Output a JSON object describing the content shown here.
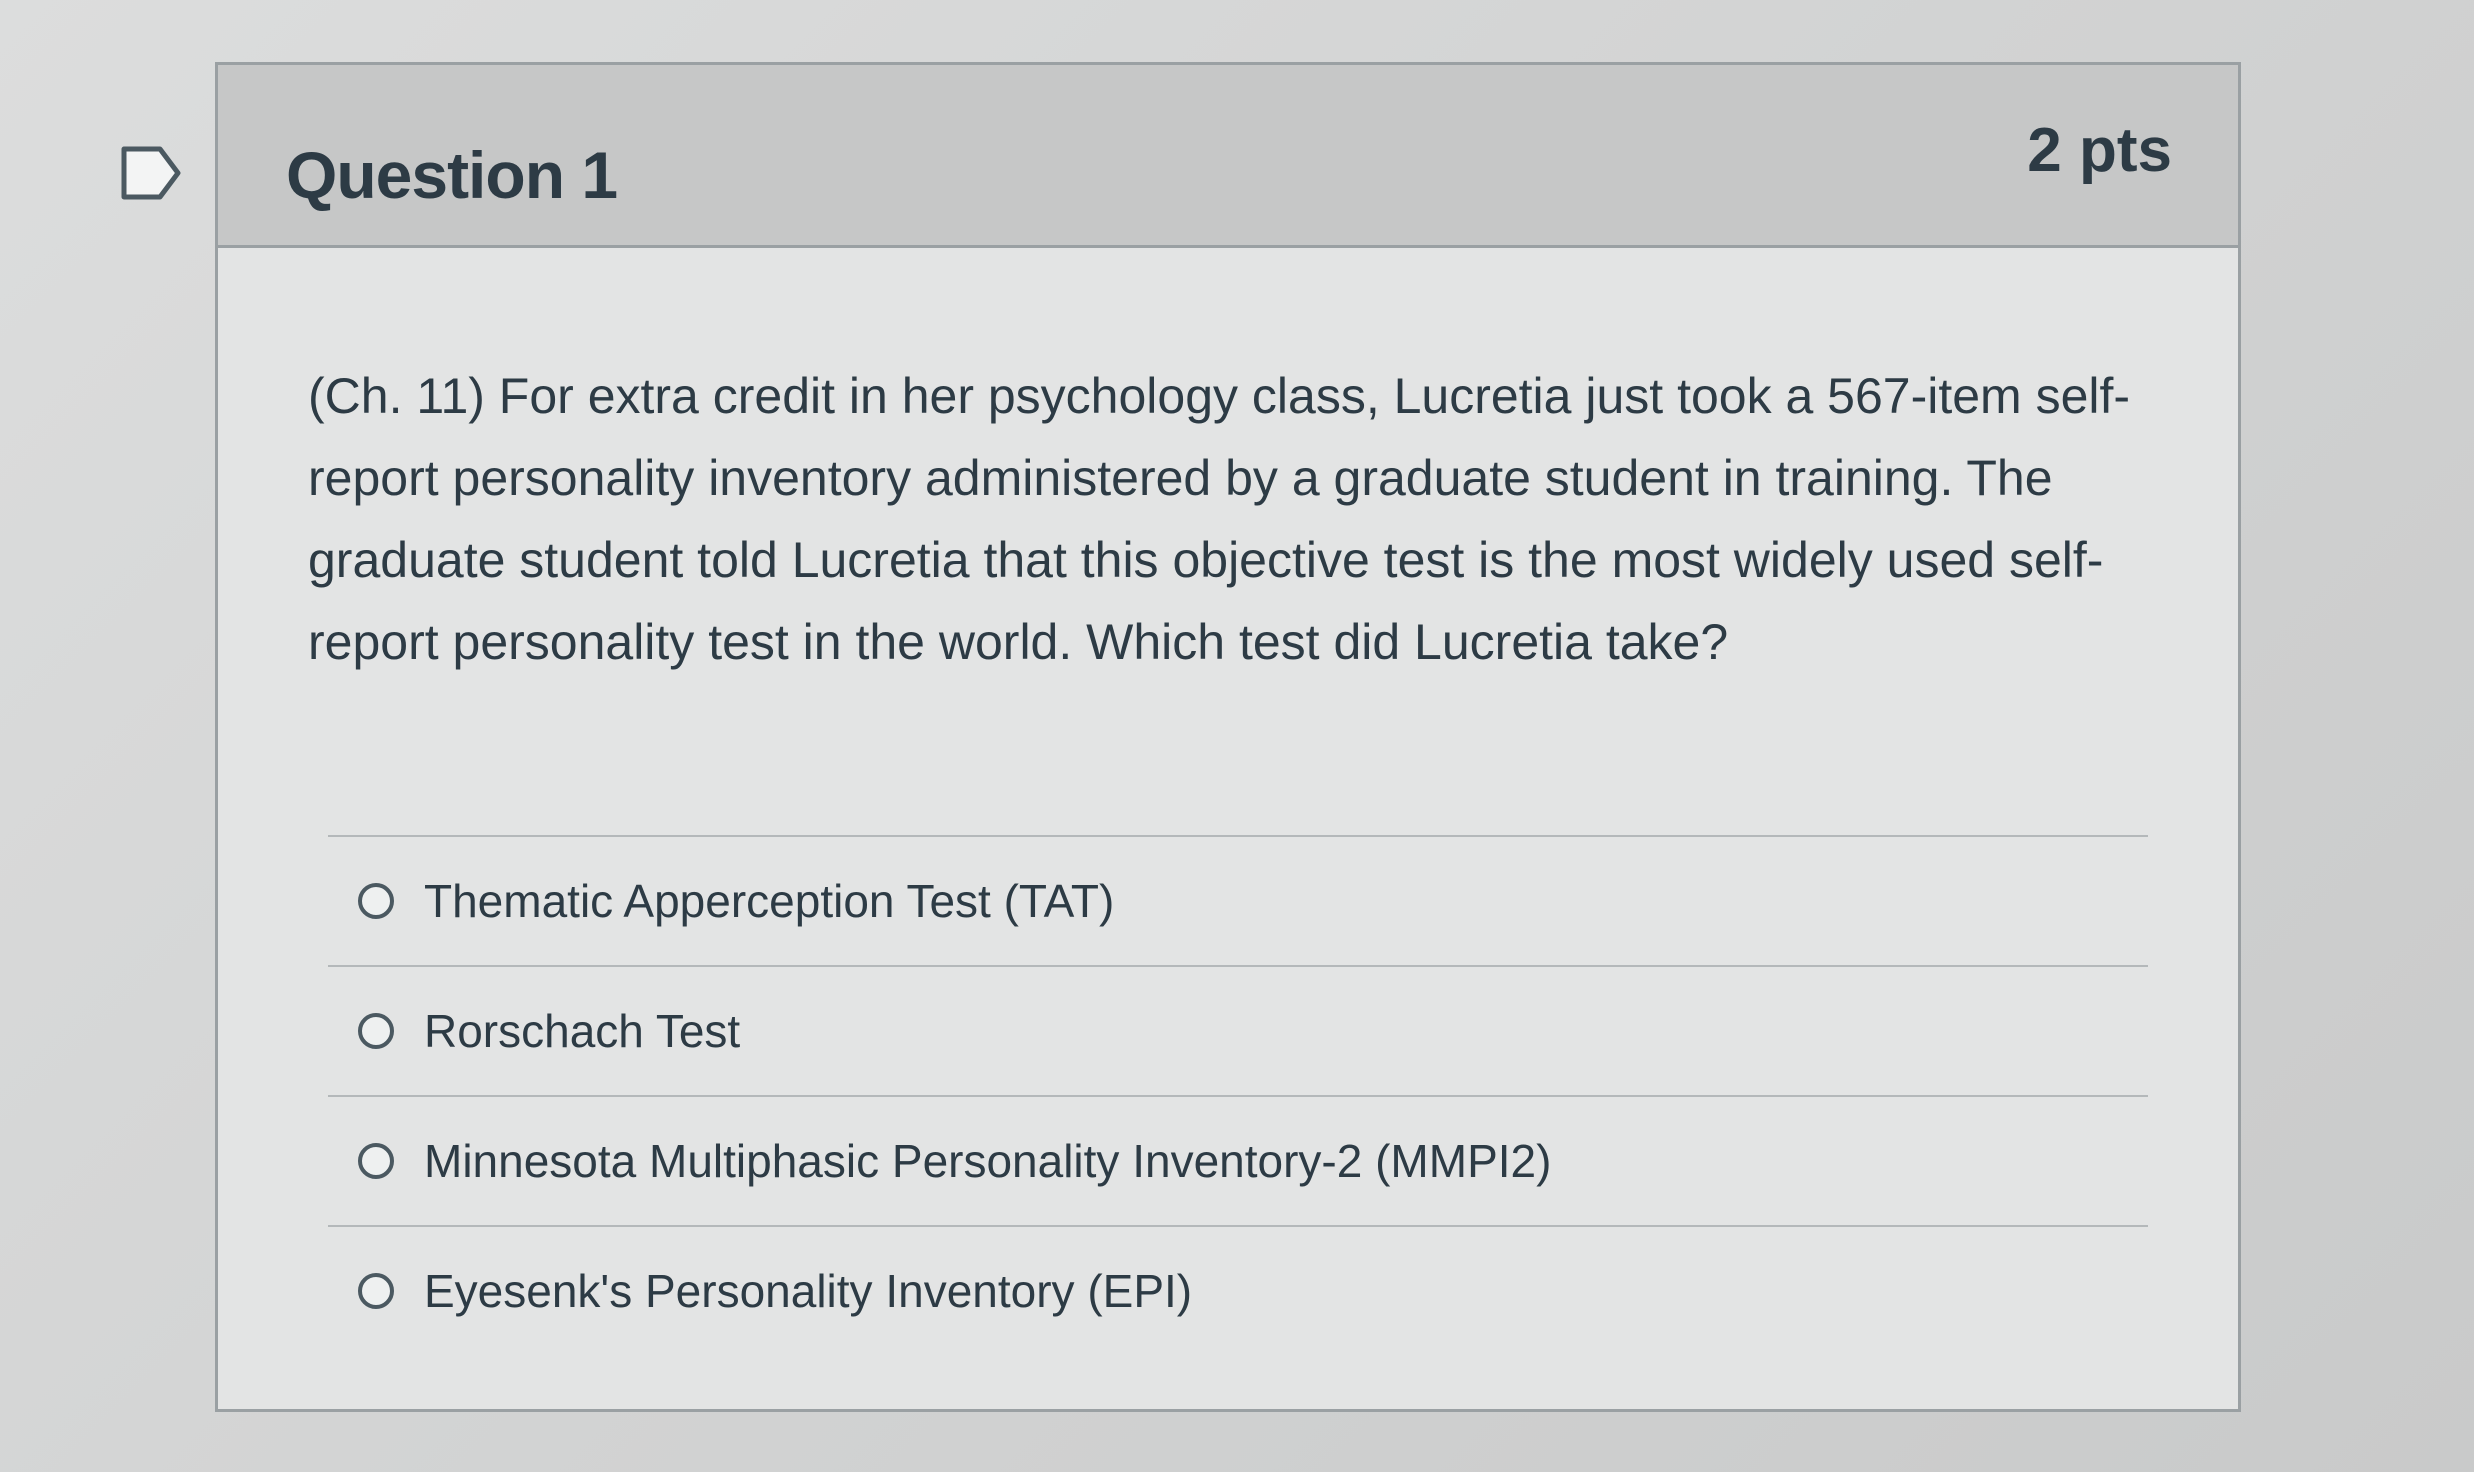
{
  "question": {
    "title": "Question 1",
    "points": "2 pts",
    "text": "(Ch. 11) For extra credit in her psychology class, Lucretia just took a 567-item self-report personality inventory administered by a graduate student in training. The graduate student told Lucretia that this objective test is the most widely used self-report personality test in the world. Which test did Lucretia take?",
    "answers": [
      {
        "label": "Thematic Apperception Test (TAT)",
        "selected": false
      },
      {
        "label": "Rorschach Test",
        "selected": false
      },
      {
        "label": "Minnesota Multiphasic Personality Inventory-2 (MMPI2)",
        "selected": false
      },
      {
        "label": "Eyesenk's Personality Inventory (EPI)",
        "selected": false
      }
    ]
  },
  "colors": {
    "text": "#2d3b45",
    "header_bg": "#c6c7c7",
    "border": "#9aa0a3"
  },
  "icons": {
    "flag": "bookmark-flag-icon"
  }
}
